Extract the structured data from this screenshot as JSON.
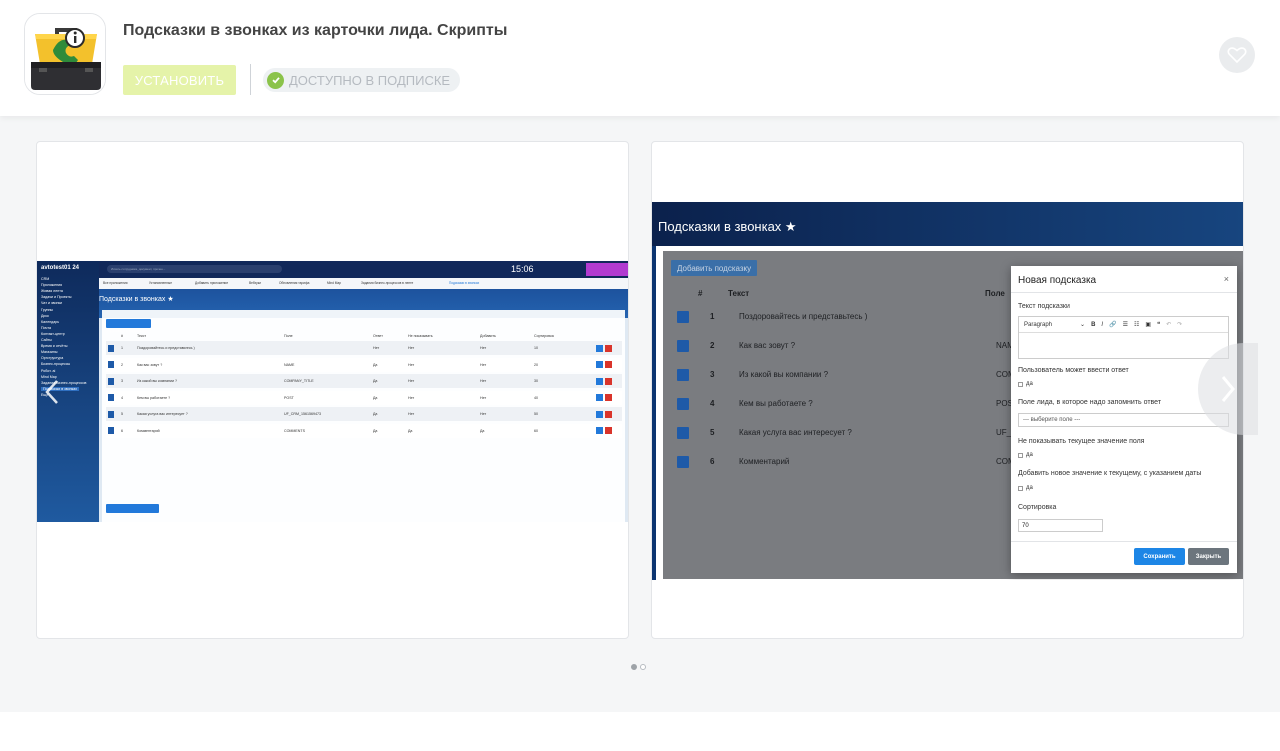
{
  "app": {
    "title": "Подсказки в звонках из карточки лида. Скрипты",
    "install_label": "УСТАНОВИТЬ",
    "availability_label": "ДОСТУПНО В ПОДПИСКЕ",
    "icon": "briefcase-phone-info-icon",
    "favorite_icon": "heart-icon"
  },
  "colors": {
    "install_button": "#e5f3a9",
    "check_badge": "#8bc34a",
    "primary_blue": "#1d86e6"
  },
  "carousel": {
    "active_index": 0,
    "total": 2,
    "prev_icon": "chevron-left-icon",
    "next_icon": "chevron-right-icon"
  },
  "screenshot1": {
    "portal": "avtotest01 24",
    "search_placeholder": "Искать сотрудника, документ, прочее...",
    "clock": "15:06",
    "page_title": "Подсказки в звонках ★",
    "add_button": "Добавить подсказку",
    "show_dialog_button": "Показать диалог звонка",
    "nav_tabs": [
      "Все приложения",
      "Установленные",
      "Добавить приложение",
      "Вебхуки",
      "Обновления тарифа",
      "Mind Map",
      "Задания бизнес-процессов в ленте",
      "Подсказки в звонках"
    ],
    "sidebar_items": [
      "CRM",
      "Приложения",
      "Живая лента",
      "Задачи и Проекты",
      "Чат и звонки",
      "Группы",
      "Диск",
      "Календарь",
      "Почта",
      "Контакт-центр",
      "Сайты",
      "Время и отчёты",
      "Магазины",
      "Оргструктура",
      "Бизнес-процессы",
      "Робот. ai",
      "Mind Map",
      "Задания бизнес-процессов",
      "Подсказки в звонках",
      "Ещё"
    ],
    "table_headers": [
      "#",
      "Текст",
      "Поле",
      "Ответ",
      "Не показывать",
      "Добавить",
      "Сортировка"
    ],
    "rows": [
      {
        "n": "1",
        "text": "Поздоровайтесь и представьтесь )",
        "field": "",
        "answer": "Нет",
        "hide": "Нет",
        "add": "Нет",
        "sort": "10"
      },
      {
        "n": "2",
        "text": "Как вас зовут ?",
        "field": "NAME",
        "answer": "Да",
        "hide": "Нет",
        "add": "Нет",
        "sort": "20"
      },
      {
        "n": "3",
        "text": "Из какой вы компании ?",
        "field": "COMPANY_TITLE",
        "answer": "Да",
        "hide": "Нет",
        "add": "Нет",
        "sort": "30"
      },
      {
        "n": "4",
        "text": "Кем вы работаете ?",
        "field": "POST",
        "answer": "Да",
        "hide": "Нет",
        "add": "Нет",
        "sort": "40"
      },
      {
        "n": "5",
        "text": "Какая услуга вас интересует ?",
        "field": "UF_CRM_1561569473",
        "answer": "Да",
        "hide": "Нет",
        "add": "Нет",
        "sort": "50"
      },
      {
        "n": "6",
        "text": "Комментарий",
        "field": "COMMENTS",
        "answer": "Да",
        "hide": "Да",
        "add": "Да",
        "sort": "60"
      }
    ]
  },
  "screenshot2": {
    "page_title": "Подсказки в звонках ★",
    "add_button": "Добавить подсказку",
    "headers": [
      "#",
      "Текст",
      "Поле"
    ],
    "rows": [
      {
        "n": "1",
        "text": "Поздоровайтесь и представьтесь )",
        "field": ""
      },
      {
        "n": "2",
        "text": "Как вас зовут ?",
        "field": "NAME"
      },
      {
        "n": "3",
        "text": "Из какой вы компании ?",
        "field": "COMPA"
      },
      {
        "n": "4",
        "text": "Кем вы работаете ?",
        "field": "POST"
      },
      {
        "n": "5",
        "text": "Какая услуга вас интересует ?",
        "field": "UF_CRM"
      },
      {
        "n": "6",
        "text": "Комментарий",
        "field": "COMM"
      }
    ],
    "modal": {
      "title": "Новая подсказка",
      "close": "×",
      "text_label": "Текст подсказки",
      "editor_format": "Paragraph",
      "user_answer_label": "Пользователь может ввести ответ",
      "yes": "да",
      "lead_field_label": "Поле лида, в которое надо запомнить ответ",
      "lead_field_select": "--- выберите поле ---",
      "hide_current_label": "Не показывать текущее значение поля",
      "append_label": "Добавить новое значение к текущему, с указанием даты",
      "sort_label": "Сортировка",
      "sort_value": "70",
      "save": "Сохранить",
      "close_button": "Закрыть"
    }
  }
}
